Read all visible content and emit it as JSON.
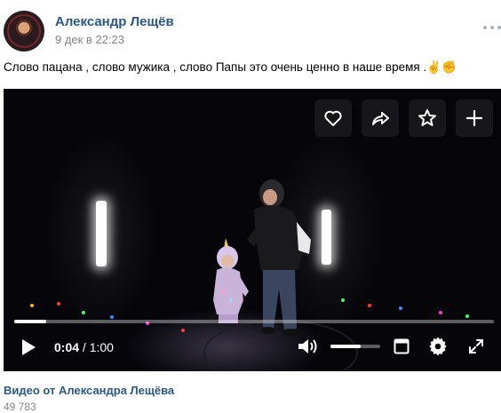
{
  "post": {
    "author_name": "Александр Лещёв",
    "date": "9 дек в 22:23",
    "text": "Слово пацана , слово мужика , слово Папы это очень ценно в наше время .✌️✊"
  },
  "video": {
    "time_current": "0:04",
    "time_separator": "/",
    "time_total": "1:00",
    "progress_fraction": 0.067,
    "volume_fraction": 0.6,
    "top_actions": [
      "heart-icon",
      "share-icon",
      "star-icon",
      "plus-icon"
    ]
  },
  "attachment": {
    "caption": "Видео от Александра Лещёва",
    "views": "49 783"
  }
}
